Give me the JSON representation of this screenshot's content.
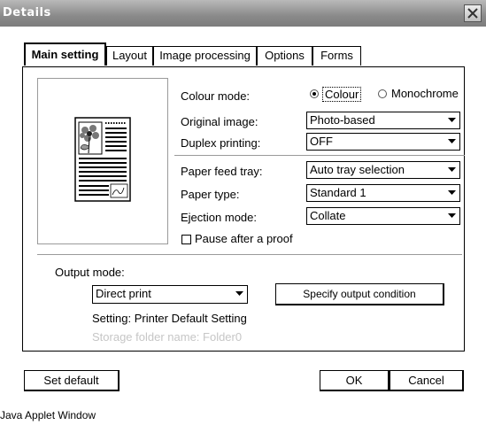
{
  "window": {
    "title": "Details",
    "status_bar": "Java Applet Window"
  },
  "tabs": [
    {
      "label": "Main setting",
      "active": true
    },
    {
      "label": "Layout"
    },
    {
      "label": "Image processing"
    },
    {
      "label": "Options"
    },
    {
      "label": "Forms"
    }
  ],
  "settings": {
    "colour_mode": {
      "label": "Colour mode:",
      "options": [
        "Colour",
        "Monochrome"
      ],
      "selected": "Colour"
    },
    "original_image": {
      "label": "Original image:",
      "value": "Photo-based"
    },
    "duplex_printing": {
      "label": "Duplex printing:",
      "value": "OFF"
    },
    "paper_feed_tray": {
      "label": "Paper feed tray:",
      "value": "Auto tray selection"
    },
    "paper_type": {
      "label": "Paper type:",
      "value": "Standard 1"
    },
    "ejection_mode": {
      "label": "Ejection mode:",
      "value": "Collate"
    },
    "pause_after_proof": {
      "label": "Pause after a proof",
      "checked": false
    }
  },
  "output": {
    "label": "Output mode:",
    "value": "Direct print",
    "specify_button": "Specify output condition",
    "setting_text": "Setting: Printer Default Setting",
    "storage_text": "Storage folder name: Folder0"
  },
  "buttons": {
    "set_default": "Set default",
    "ok": "OK",
    "cancel": "Cancel"
  }
}
